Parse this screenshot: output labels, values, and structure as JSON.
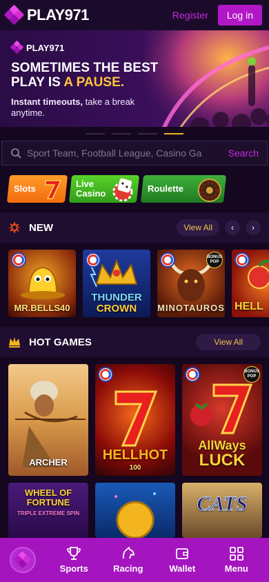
{
  "header": {
    "brand": "PLAY971",
    "register_label": "Register",
    "login_label": "Log in"
  },
  "banner": {
    "brand": "PLAY971",
    "headline_part1": "SOMETIMES THE BEST PLAY IS ",
    "headline_highlight": "A PAUSE.",
    "sub_bold": "Instant timeouts,",
    "sub_rest": " take a break anytime.",
    "slides": 4,
    "active_slide": 4
  },
  "search": {
    "placeholder": "Sport Team, Football League, Casino Ga",
    "button_label": "Search"
  },
  "chips": [
    {
      "label": "Slots"
    },
    {
      "label_line1": "Live",
      "label_line2": "Casino"
    },
    {
      "label": "Roulette"
    }
  ],
  "sections": {
    "new": {
      "title": "NEW",
      "view_all": "View All",
      "prev": "‹",
      "next": "›"
    },
    "hot": {
      "title": "HOT GAMES",
      "view_all": "View All"
    }
  },
  "new_games": [
    {
      "name": "MR.BELLS40"
    },
    {
      "name_line1": "THUNDER",
      "name_line2": "CROWN"
    },
    {
      "name": "MINOTAUROS"
    },
    {
      "name": "HELL"
    }
  ],
  "hot_games": [
    {
      "name": "ARCHER"
    },
    {
      "name": "HELLHOT",
      "sub": "100"
    },
    {
      "name_line1": "AllWays",
      "name_line2": "LUCK"
    },
    {
      "name_line1": "WHEEL OF",
      "name_line2": "FORTUNE",
      "name_line3": "TRIPLE EXTREME SPIN"
    },
    {
      "name": ""
    },
    {
      "name": "CATS"
    }
  ],
  "bonus_pop": "BONUS POP",
  "nav": {
    "sports": "Sports",
    "racing": "Racing",
    "wallet": "Wallet",
    "menu": "Menu"
  },
  "colors": {
    "accent": "#b117c6",
    "nav_bg": "#a414bf",
    "gold": "#f0c24a"
  }
}
